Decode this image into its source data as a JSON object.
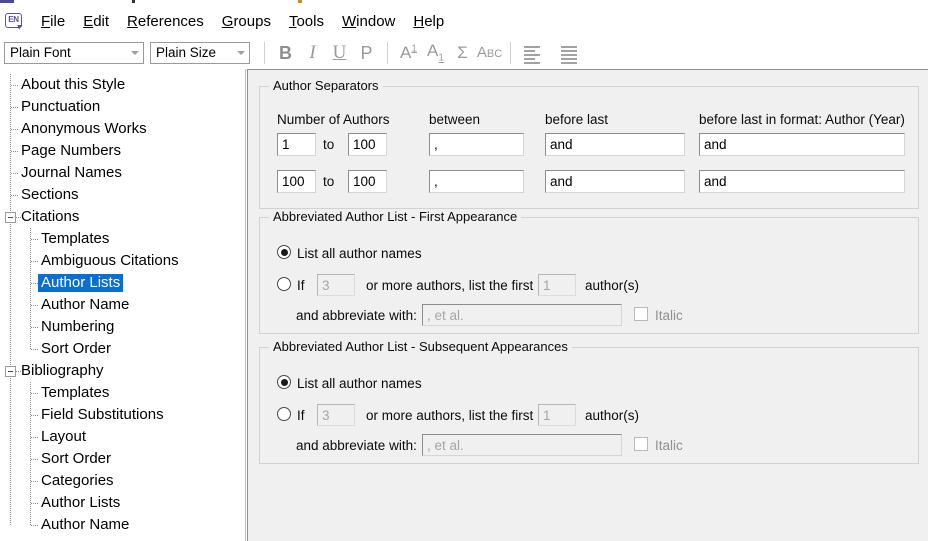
{
  "app": {
    "brand_icon": "endnote-en-icon",
    "brand_text": "EN",
    "accent_blue": "#0b6ed1",
    "brand_purple": "#5a4fa3"
  },
  "menubar": {
    "items": [
      {
        "label": "File",
        "accel": "F"
      },
      {
        "label": "Edit",
        "accel": "E"
      },
      {
        "label": "References",
        "accel": "R"
      },
      {
        "label": "Groups",
        "accel": "G"
      },
      {
        "label": "Tools",
        "accel": "T"
      },
      {
        "label": "Window",
        "accel": "W"
      },
      {
        "label": "Help",
        "accel": "H"
      }
    ]
  },
  "toolbar": {
    "font_combo": {
      "value": "Plain Font",
      "icon": "chevron-down-icon"
    },
    "size_combo": {
      "value": "Plain Size",
      "icon": "chevron-down-icon"
    },
    "buttons": [
      {
        "name": "bold-button",
        "glyph": "B"
      },
      {
        "name": "italic-button",
        "glyph": "I"
      },
      {
        "name": "underline-button",
        "glyph": "U"
      },
      {
        "name": "plain-button",
        "glyph": "P"
      },
      {
        "name": "superscript-button",
        "glyph": "A1"
      },
      {
        "name": "subscript-button",
        "glyph": "A1"
      },
      {
        "name": "insert-symbol-button",
        "glyph": "Σ"
      },
      {
        "name": "spell-check-button",
        "glyph": "ABC"
      },
      {
        "name": "align-left-button",
        "glyph": "align"
      },
      {
        "name": "align-justify-button",
        "glyph": "align"
      }
    ]
  },
  "tree": {
    "selected": "Author Lists",
    "nodes": [
      {
        "label": "About this Style",
        "level": 1,
        "type": "leaf"
      },
      {
        "label": "Punctuation",
        "level": 1,
        "type": "leaf"
      },
      {
        "label": "Anonymous Works",
        "level": 1,
        "type": "leaf"
      },
      {
        "label": "Page Numbers",
        "level": 1,
        "type": "leaf"
      },
      {
        "label": "Journal Names",
        "level": 1,
        "type": "leaf"
      },
      {
        "label": "Sections",
        "level": 1,
        "type": "leaf"
      },
      {
        "label": "Citations",
        "level": 1,
        "type": "expanded"
      },
      {
        "label": "Templates",
        "level": 2,
        "type": "leaf"
      },
      {
        "label": "Ambiguous Citations",
        "level": 2,
        "type": "leaf"
      },
      {
        "label": "Author Lists",
        "level": 2,
        "type": "leaf",
        "selected": true
      },
      {
        "label": "Author Name",
        "level": 2,
        "type": "leaf"
      },
      {
        "label": "Numbering",
        "level": 2,
        "type": "leaf"
      },
      {
        "label": "Sort Order",
        "level": 2,
        "type": "leaf"
      },
      {
        "label": "Bibliography",
        "level": 1,
        "type": "expanded"
      },
      {
        "label": "Templates",
        "level": 2,
        "type": "leaf"
      },
      {
        "label": "Field Substitutions",
        "level": 2,
        "type": "leaf"
      },
      {
        "label": "Layout",
        "level": 2,
        "type": "leaf"
      },
      {
        "label": "Sort Order",
        "level": 2,
        "type": "leaf"
      },
      {
        "label": "Categories",
        "level": 2,
        "type": "leaf"
      },
      {
        "label": "Author Lists",
        "level": 2,
        "type": "leaf"
      },
      {
        "label": "Author Name",
        "level": 2,
        "type": "leaf"
      }
    ]
  },
  "author_separators": {
    "title": "Author Separators",
    "columns": {
      "number_of_authors": "Number of Authors",
      "between": "between",
      "before_last": "before last",
      "before_last_in_format": "before last in format: Author (Year)"
    },
    "to_label": "to",
    "rows": [
      {
        "from": "1",
        "to": "100",
        "between": ",",
        "before_last": "and",
        "before_last_format": "and"
      },
      {
        "from": "100",
        "to": "100",
        "between": ",",
        "before_last": "and",
        "before_last_format": "and"
      }
    ]
  },
  "first_appearance": {
    "title": "Abbreviated Author List - First Appearance",
    "list_all_label": "List all author names",
    "list_all_selected": true,
    "if_label": "If",
    "if_value": "3",
    "or_more_label": "or more authors, list the first",
    "first_value": "1",
    "authors_label": "author(s)",
    "abbrev_label": "and abbreviate with:",
    "abbrev_value": ", et al.",
    "italic_label": "Italic",
    "italic_checked": false
  },
  "subsequent_appearances": {
    "title": "Abbreviated Author List - Subsequent Appearances",
    "list_all_label": "List all author names",
    "list_all_selected": true,
    "if_label": "If",
    "if_value": "3",
    "or_more_label": "or more authors, list the first",
    "first_value": "1",
    "authors_label": "author(s)",
    "abbrev_label": "and abbreviate with:",
    "abbrev_value": ", et al.",
    "italic_label": "Italic",
    "italic_checked": false
  }
}
